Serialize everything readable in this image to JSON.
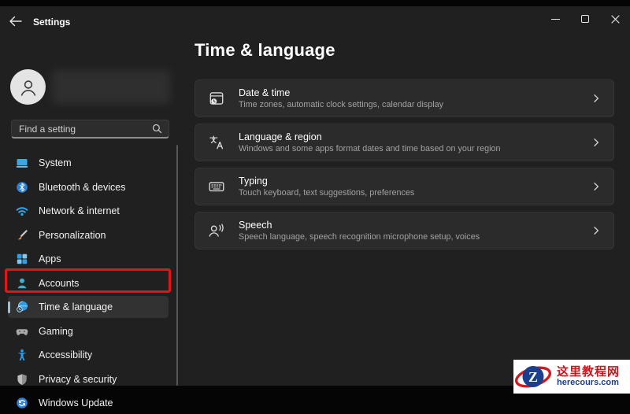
{
  "titlebar": {
    "app_title": "Settings",
    "back_icon": "back-arrow-icon",
    "controls": [
      "minimize",
      "maximize",
      "close"
    ]
  },
  "sidebar": {
    "avatar_icon": "person-icon",
    "user_name_visible": false,
    "search": {
      "placeholder": "Find a setting",
      "icon": "magnifier-icon"
    },
    "items": [
      {
        "label": "System",
        "icon": "system-icon"
      },
      {
        "label": "Bluetooth & devices",
        "icon": "bluetooth-icon"
      },
      {
        "label": "Network & internet",
        "icon": "network-icon"
      },
      {
        "label": "Personalization",
        "icon": "personalization-icon"
      },
      {
        "label": "Apps",
        "icon": "apps-icon"
      },
      {
        "label": "Accounts",
        "icon": "accounts-icon"
      },
      {
        "label": "Time & language",
        "icon": "time-language-icon",
        "selected": true,
        "annotated": true
      },
      {
        "label": "Gaming",
        "icon": "gaming-icon"
      },
      {
        "label": "Accessibility",
        "icon": "accessibility-icon"
      },
      {
        "label": "Privacy & security",
        "icon": "privacy-icon"
      },
      {
        "label": "Windows Update",
        "icon": "windows-update-icon"
      }
    ]
  },
  "main": {
    "page_title": "Time & language",
    "cards": [
      {
        "title": "Date & time",
        "subtitle": "Time zones, automatic clock settings, calendar display",
        "icon": "date-time-icon"
      },
      {
        "title": "Language & region",
        "subtitle": "Windows and some apps format dates and time based on your region",
        "icon": "language-region-icon"
      },
      {
        "title": "Typing",
        "subtitle": "Touch keyboard, text suggestions, preferences",
        "icon": "typing-icon"
      },
      {
        "title": "Speech",
        "subtitle": "Speech language, speech recognition microphone setup, voices",
        "icon": "speech-icon"
      }
    ]
  },
  "annotation": {
    "type": "red-highlight-box",
    "target": "Time & language",
    "color": "#e2151d"
  },
  "watermark": {
    "logo_letter": "Z",
    "site_name": "这里教程网",
    "site_url": "herecours.com"
  },
  "colors": {
    "window_bg": "#202020",
    "card_bg": "#2b2b2b",
    "selected_item_bg": "#323232",
    "accent_pill": "#a6bac7",
    "annotation_red": "#e2151d",
    "watermark_red": "#c8161e",
    "watermark_blue": "#1c3e8e"
  }
}
